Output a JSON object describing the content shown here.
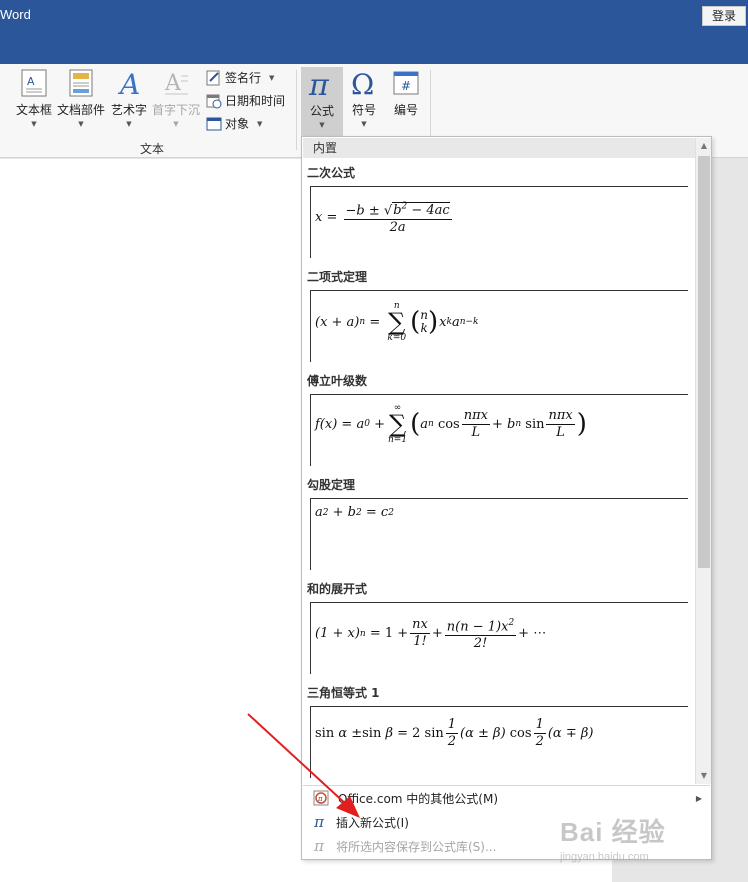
{
  "titlebar": {
    "app_title": "Word",
    "login_label": "登录"
  },
  "ribbon": {
    "textbox_label": "文本框",
    "quickparts_label": "文档部件",
    "wordart_label": "艺术字",
    "dropcap_label": "首字下沉",
    "signature_label": "签名行",
    "datetime_label": "日期和时间",
    "object_label": "对象",
    "group_text_label": "文本",
    "equation_label": "公式",
    "symbol_label": "符号",
    "number_label": "编号"
  },
  "gallery": {
    "header": "内置",
    "items": [
      {
        "title": "二次公式"
      },
      {
        "title": "二项式定理"
      },
      {
        "title": "傅立叶级数"
      },
      {
        "title": "勾股定理"
      },
      {
        "title": "和的展开式"
      },
      {
        "title": "三角恒等式 1"
      }
    ]
  },
  "menu": {
    "office_more": "Office.com 中的其他公式(M)",
    "insert_new": "插入新公式(I)",
    "save_selection": "将所选内容保存到公式库(S)..."
  },
  "watermark": {
    "text": "Bai 经验",
    "url": "jingyan.baidu.com"
  },
  "colors": {
    "titlebar": "#2b579a",
    "ribbon": "#f7f7f7",
    "annotation_arrow": "#e02020"
  }
}
